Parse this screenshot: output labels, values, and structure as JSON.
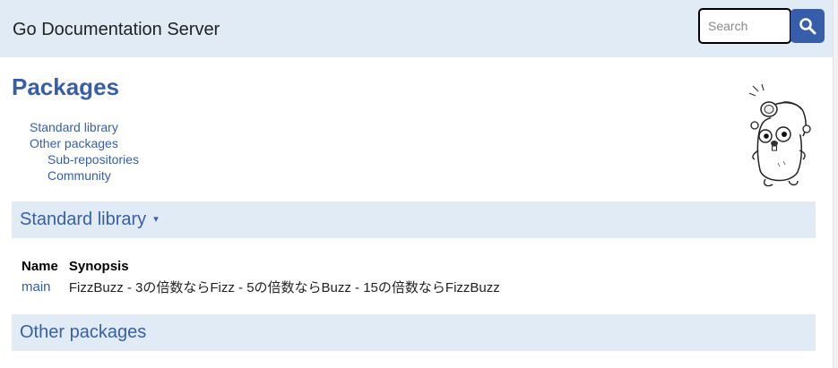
{
  "header": {
    "title": "Go Documentation Server",
    "search_placeholder": "Search"
  },
  "main": {
    "title": "Packages",
    "toc": [
      "Standard library",
      "Other packages",
      "Sub-repositories",
      "Community"
    ],
    "sections": {
      "standard_library": {
        "label": "Standard library",
        "toggle": "▾"
      },
      "other_packages": {
        "label": "Other packages"
      }
    },
    "table": {
      "headers": [
        "Name",
        "Synopsis"
      ],
      "rows": [
        {
          "name": "main",
          "synopsis": "FizzBuzz - 3の倍数ならFizz - 5の倍数ならBuzz - 15の倍数ならFizzBuzz"
        }
      ]
    }
  },
  "colors": {
    "accent": "#375eab",
    "header_bg": "#e0ebf5"
  },
  "icons": {
    "search": "magnifier-icon",
    "mascot": "gopher-illustration"
  }
}
